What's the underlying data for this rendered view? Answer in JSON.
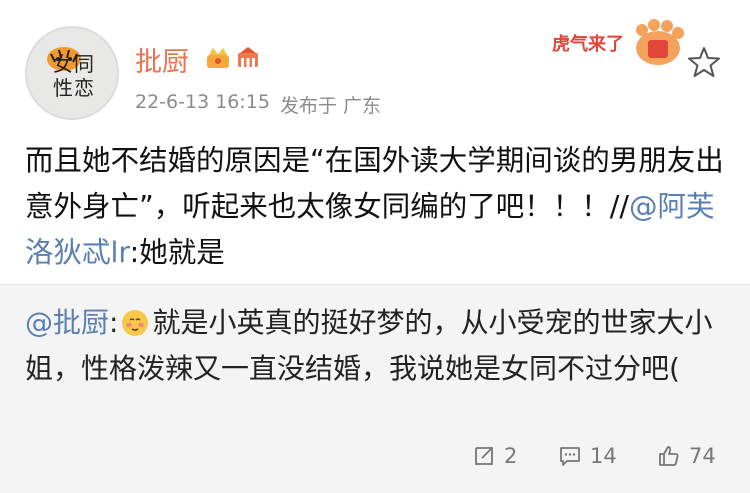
{
  "user": {
    "name": "批厨",
    "avatar_text": "女同性恋"
  },
  "meta": {
    "timestamp": "22-6-13 16:15",
    "source": "发布于 广东"
  },
  "post": {
    "text": "而且她不结婚的原因是“在国外读大学期间谈的男朋友出意外身亡”，听起来也太像女同编的了吧！！！//",
    "mention": "@阿芙洛狄忒lr",
    "text_after": ":她就是"
  },
  "comment": {
    "mention": "@批厨",
    "colon": ":",
    "text": "就是小英真的挺好梦的，从小受宠的世家大小姐，性格泼辣又一直没结婚，我说她是女同不过分吧("
  },
  "promo": {
    "text": "虎气来了"
  },
  "actions": {
    "repost_count": "2",
    "comment_count": "14",
    "like_count": "74"
  },
  "icons": [
    "star-icon",
    "repost-icon",
    "comment-icon",
    "like-icon",
    "crown-badge-icon",
    "fan-badge-icon",
    "tiger-paw-icon"
  ],
  "colors": {
    "username": "#eb7350",
    "mention": "#5a7fb3",
    "comment_bg": "#f4f4f4"
  }
}
